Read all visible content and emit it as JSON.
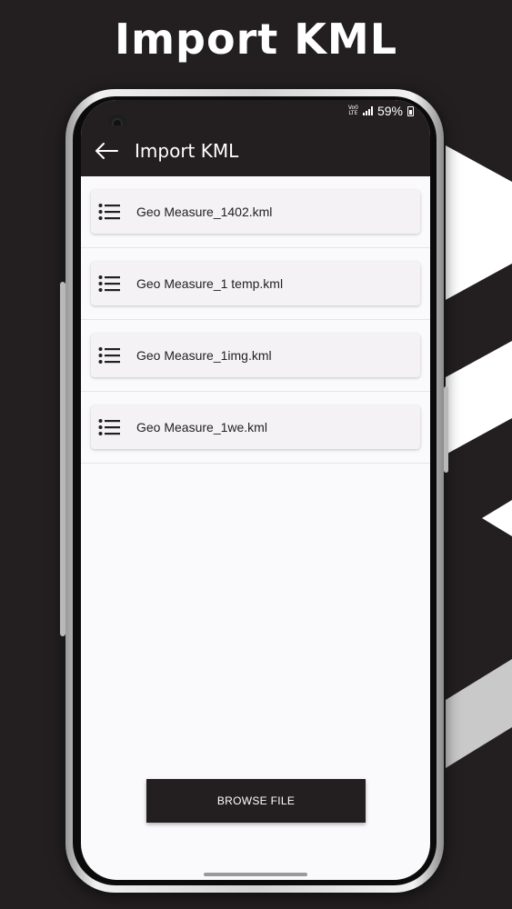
{
  "promo": {
    "title": "Import KML"
  },
  "status_bar": {
    "network_top": "Vo0",
    "network_bottom": "LTE",
    "battery": "59%"
  },
  "app_bar": {
    "title": "Import KML",
    "back_icon": "arrow-left-icon"
  },
  "files": [
    {
      "name": "Geo Measure_1402.kml",
      "icon": "list-icon"
    },
    {
      "name": "Geo Measure_1 temp.kml",
      "icon": "list-icon"
    },
    {
      "name": "Geo Measure_1img.kml",
      "icon": "list-icon"
    },
    {
      "name": "Geo Measure_1we.kml",
      "icon": "list-icon"
    }
  ],
  "browse_button": {
    "label": "BROWSE FILE"
  },
  "colors": {
    "background": "#231f20",
    "app_bar": "#231f20",
    "screen": "#faf9fb",
    "card": "#f4f2f5",
    "button": "#231f20"
  }
}
